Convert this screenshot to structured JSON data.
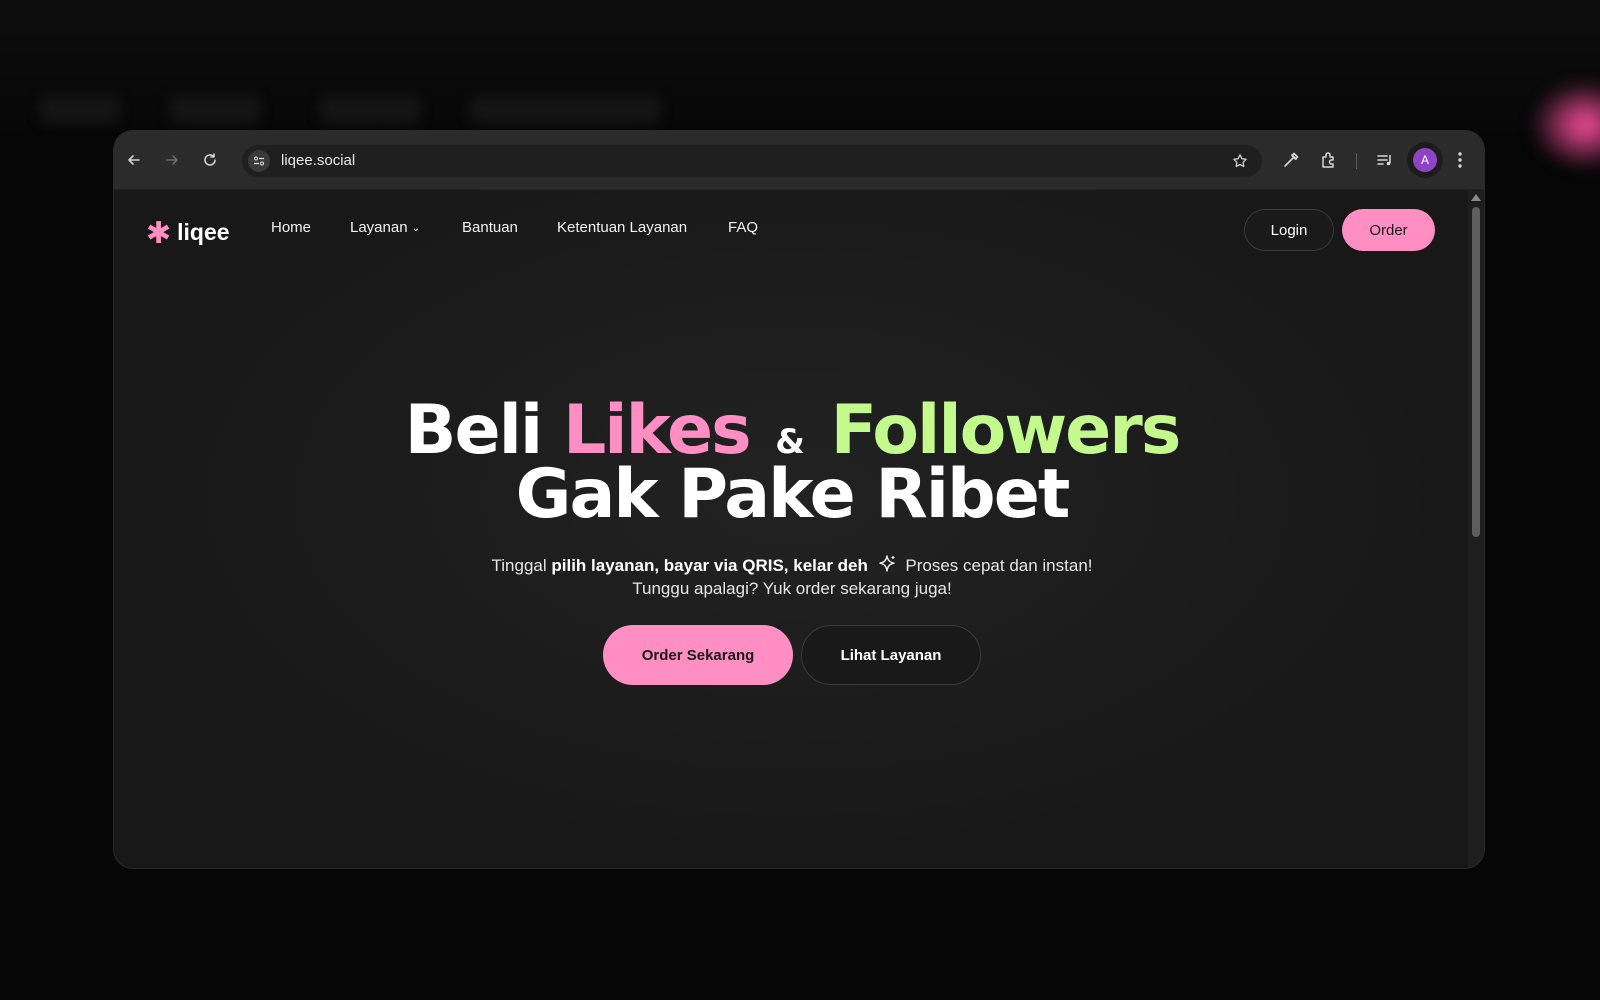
{
  "browser": {
    "url": "liqee.social",
    "profile_initial": "A"
  },
  "nav": {
    "logo_text": "liqee",
    "links": [
      "Home",
      "Layanan",
      "Bantuan",
      "Ketentuan Layanan",
      "FAQ"
    ],
    "login_label": "Login",
    "order_label": "Order"
  },
  "hero": {
    "word_beli": "Beli",
    "word_likes": "Likes",
    "amp": "&",
    "word_followers": "Followers",
    "line2": "Gak Pake Ribet",
    "sub1_pre": "Tinggal",
    "sub1_bold": "pilih layanan, bayar via QRIS, kelar deh",
    "sub1_post": "Proses cepat dan instan!",
    "sub2": "Tunggu apalagi? Yuk order sekarang juga!",
    "cta_primary": "Order Sekarang",
    "cta_secondary": "Lihat Layanan"
  },
  "colors": {
    "pink": "#ff8ec3",
    "green": "#c3f98d",
    "background": "#181818"
  }
}
